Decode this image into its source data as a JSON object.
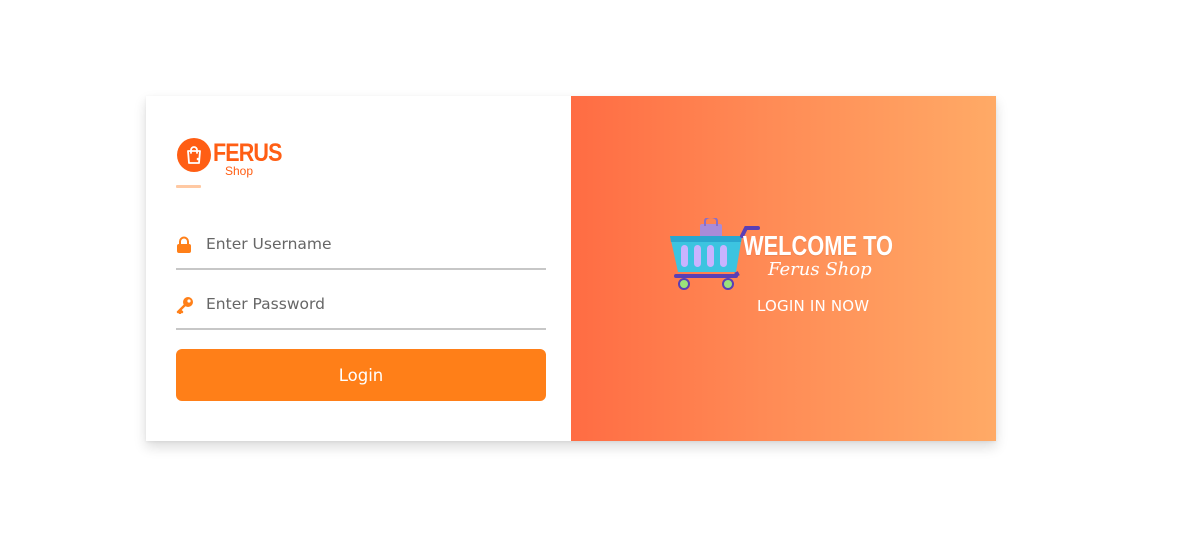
{
  "brand": {
    "title": "FERUS",
    "subtitle": "Shop",
    "color": "#ff5e14"
  },
  "form": {
    "username": {
      "placeholder": "Enter Username",
      "value": "",
      "icon": "lock-icon"
    },
    "password": {
      "placeholder": "Enter Password",
      "value": "",
      "icon": "key-icon"
    },
    "login_label": "Login",
    "button_color": "#ff7f18"
  },
  "welcome_panel": {
    "heading": "WELCOME TO",
    "brand_script": "Ferus Shop",
    "cta": "LOGIN IN NOW",
    "illustration": "shopping-cart-icon",
    "gradient_start": "#ff6c43",
    "gradient_end": "#ffaa66"
  }
}
